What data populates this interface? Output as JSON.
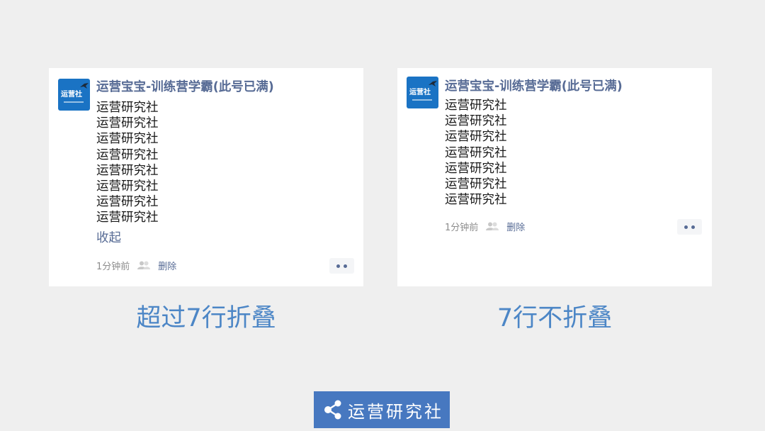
{
  "left_card": {
    "avatar_text": "运营社",
    "poster_name": "运营宝宝-训练营学霸(此号已满)",
    "lines": [
      "运营研究社",
      "运营研究社",
      "运营研究社",
      "运营研究社",
      "运营研究社",
      "运营研究社",
      "运营研究社",
      "运营研究社"
    ],
    "collapse_label": "收起",
    "time": "1分钟前",
    "delete_label": "删除"
  },
  "right_card": {
    "avatar_text": "运营社",
    "poster_name": "运营宝宝-训练营学霸(此号已满)",
    "lines": [
      "运营研究社",
      "运营研究社",
      "运营研究社",
      "运营研究社",
      "运营研究社",
      "运营研究社",
      "运营研究社"
    ],
    "time": "1分钟前",
    "delete_label": "删除"
  },
  "captions": {
    "left": "超过7行折叠",
    "right": "7行不折叠"
  },
  "brand": {
    "name": "运营研究社",
    "icon": "share-icon"
  },
  "colors": {
    "background": "#efefef",
    "card": "#ffffff",
    "link": "#576b95",
    "caption": "#4c86c6",
    "brand_bg": "#4778c0",
    "avatar_bg": "#1a73c4"
  },
  "icons": {
    "people": "people-icon",
    "more": "more-dots-icon",
    "avatar": "bird-logo"
  }
}
